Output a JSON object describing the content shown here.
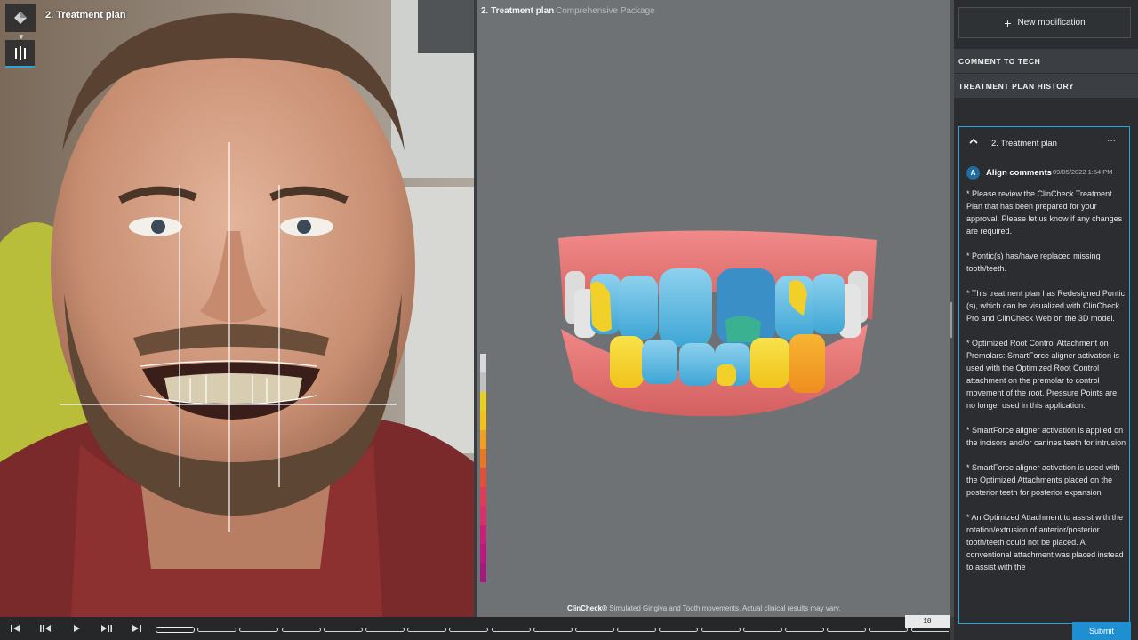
{
  "header": {
    "left_title": "2. Treatment plan",
    "viewer_title": "2. Treatment plan",
    "viewer_subtitle": "Comprehensive Package"
  },
  "icons": {
    "logo": "invisalign-diamond-icon",
    "view_toggle": "bars-icon",
    "new_mod": "plus-icon",
    "collapse": "chevron-up-icon",
    "more": "ellipsis-icon"
  },
  "viewer": {
    "disclaimer_brand": "ClinCheck®",
    "disclaimer_text": " Simulated Gingiva and Tooth movements. Actual clinical results may vary.",
    "scale_colors": [
      "#d8d8d8",
      "#c0c0c0",
      "#e8d020",
      "#f2c21a",
      "#f0a020",
      "#e8781f",
      "#e0503a",
      "#e03c5a",
      "#d8306a",
      "#c8207a",
      "#b81a80",
      "#a01a80"
    ]
  },
  "sidebar": {
    "new_modification": "New modification",
    "comment_to_tech": "COMMENT TO TECH",
    "treatment_plan_history": "TREATMENT PLAN HISTORY",
    "card": {
      "title": "2. Treatment plan",
      "more": "···",
      "avatar": "A",
      "author": "Align comments",
      "date": "09/05/2022 1:54 PM",
      "paragraphs": [
        "* Please review the ClinCheck Treatment Plan that has been prepared for your approval. Please let us know if any changes are required.",
        "* Pontic(s) has/have replaced missing tooth/teeth.",
        "* This treatment plan has Redesigned Pontic (s), which can be visualized with ClinCheck Pro and ClinCheck Web on the 3D model.",
        "* Optimized Root Control Attachment on Premolars: SmartForce aligner activation is used with the Optimized Root Control attachment on the premolar to control movement of the root. Pressure Points are no longer used in this application.",
        "* SmartForce aligner activation is applied on the incisors and/or canines teeth for intrusion",
        "* SmartForce aligner activation is used with the Optimized Attachments placed on the posterior teeth for posterior expansion",
        "* An Optimized Attachment to assist with the rotation/extrusion of anterior/posterior tooth/teeth could not be placed. A conventional attachment was placed instead to assist with the"
      ]
    },
    "submit": "Submit"
  },
  "timeline": {
    "stage_count": "18",
    "segments": 19
  }
}
